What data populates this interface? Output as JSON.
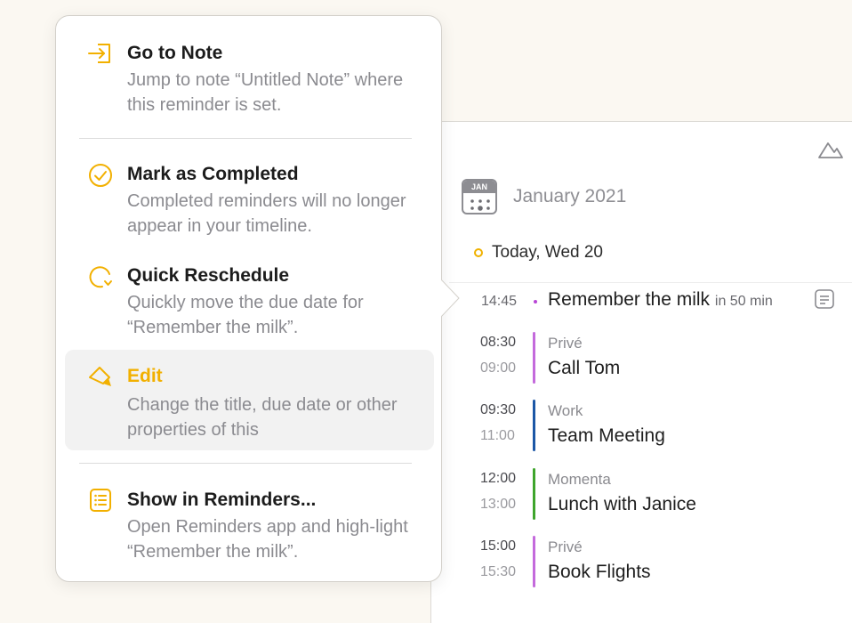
{
  "colors": {
    "accent": "#f2b000",
    "prive": "#c46adc",
    "work": "#1c57a6",
    "momenta": "#3fa52c",
    "background": "#fbf8f2"
  },
  "popover": {
    "items": [
      {
        "icon": "go-to-note-icon",
        "title": "Go to Note",
        "desc": "Jump to note “Untitled Note” where this reminder is set."
      },
      {
        "icon": "checkmark-circle-icon",
        "title": "Mark as Completed",
        "desc": "Completed reminders will no longer appear in your timeline."
      },
      {
        "icon": "reschedule-icon",
        "title": "Quick Reschedule",
        "desc": "Quickly move the due date for “Remember the milk”."
      },
      {
        "icon": "edit-pen-icon",
        "title": "Edit",
        "desc": "Change the title, due date or other properties of this"
      },
      {
        "icon": "reminders-list-icon",
        "title": "Show in Reminders...",
        "desc": "Open Reminders app and high-light “Remember the milk”."
      }
    ]
  },
  "timeline": {
    "calendar_badge": "JAN",
    "month": "January 2021",
    "today": "Today, Wed 20",
    "reminder": {
      "time": "14:45",
      "title": "Remember the milk",
      "relative": "in 50 min"
    },
    "events": [
      {
        "start": "08:30",
        "end": "09:00",
        "calendar": "Privé",
        "title": "Call Tom",
        "color": "#c46adc"
      },
      {
        "start": "09:30",
        "end": "11:00",
        "calendar": "Work",
        "title": "Team Meeting",
        "color": "#1c57a6"
      },
      {
        "start": "12:00",
        "end": "13:00",
        "calendar": "Momenta",
        "title": "Lunch with Janice",
        "color": "#3fa52c"
      },
      {
        "start": "15:00",
        "end": "15:30",
        "calendar": "Privé",
        "title": "Book Flights",
        "color": "#c46adc"
      }
    ]
  }
}
